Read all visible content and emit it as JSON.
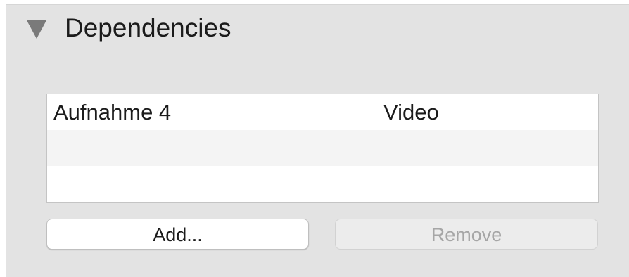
{
  "section": {
    "title": "Dependencies",
    "disclosure_state": "expanded"
  },
  "dependencies": {
    "rows": [
      {
        "name": "Aufnahme 4",
        "type": "Video"
      },
      {
        "name": "",
        "type": ""
      },
      {
        "name": "",
        "type": ""
      }
    ]
  },
  "buttons": {
    "add_label": "Add...",
    "remove_label": "Remove",
    "remove_enabled": false
  },
  "colors": {
    "panel_background": "#e3e3e3",
    "alternate_row": "#f4f4f4",
    "disabled_text": "#a6a6a6"
  }
}
